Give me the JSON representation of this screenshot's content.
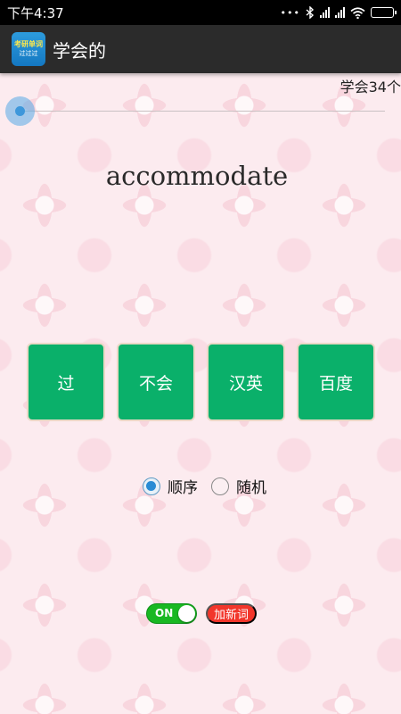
{
  "status_bar": {
    "time": "下午4:37"
  },
  "app": {
    "icon_line1": "考研单词",
    "icon_line2": "过过过",
    "title": "学会的"
  },
  "progress": {
    "learned_label": "学会34个",
    "seek_fraction": 0.0
  },
  "word": "accommodate",
  "buttons": {
    "pass": "过",
    "dont_know": "不会",
    "zh_en": "汉英",
    "baidu": "百度"
  },
  "order": {
    "sequential": "顺序",
    "random": "随机",
    "selected": "sequential"
  },
  "toggle": {
    "state_label": "ON"
  },
  "add_word_label": "加新词",
  "colors": {
    "button_green": "#0ab06a",
    "toggle_green": "#19b822",
    "add_word_red": "#f2362b",
    "accent_blue": "#2a8bd4"
  }
}
